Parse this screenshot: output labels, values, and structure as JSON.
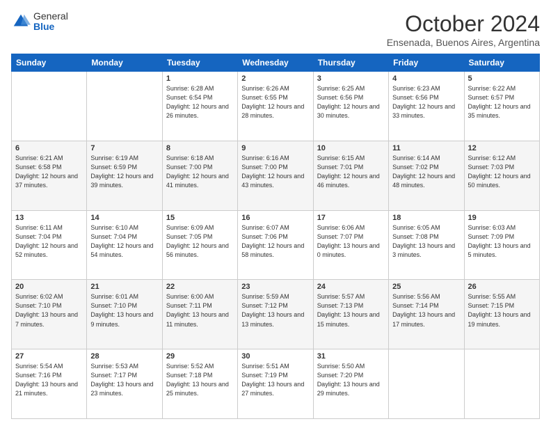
{
  "logo": {
    "general": "General",
    "blue": "Blue"
  },
  "header": {
    "month": "October 2024",
    "location": "Ensenada, Buenos Aires, Argentina"
  },
  "days_of_week": [
    "Sunday",
    "Monday",
    "Tuesday",
    "Wednesday",
    "Thursday",
    "Friday",
    "Saturday"
  ],
  "weeks": [
    [
      {
        "day": "",
        "sunrise": "",
        "sunset": "",
        "daylight": ""
      },
      {
        "day": "",
        "sunrise": "",
        "sunset": "",
        "daylight": ""
      },
      {
        "day": "1",
        "sunrise": "Sunrise: 6:28 AM",
        "sunset": "Sunset: 6:54 PM",
        "daylight": "Daylight: 12 hours and 26 minutes."
      },
      {
        "day": "2",
        "sunrise": "Sunrise: 6:26 AM",
        "sunset": "Sunset: 6:55 PM",
        "daylight": "Daylight: 12 hours and 28 minutes."
      },
      {
        "day": "3",
        "sunrise": "Sunrise: 6:25 AM",
        "sunset": "Sunset: 6:56 PM",
        "daylight": "Daylight: 12 hours and 30 minutes."
      },
      {
        "day": "4",
        "sunrise": "Sunrise: 6:23 AM",
        "sunset": "Sunset: 6:56 PM",
        "daylight": "Daylight: 12 hours and 33 minutes."
      },
      {
        "day": "5",
        "sunrise": "Sunrise: 6:22 AM",
        "sunset": "Sunset: 6:57 PM",
        "daylight": "Daylight: 12 hours and 35 minutes."
      }
    ],
    [
      {
        "day": "6",
        "sunrise": "Sunrise: 6:21 AM",
        "sunset": "Sunset: 6:58 PM",
        "daylight": "Daylight: 12 hours and 37 minutes."
      },
      {
        "day": "7",
        "sunrise": "Sunrise: 6:19 AM",
        "sunset": "Sunset: 6:59 PM",
        "daylight": "Daylight: 12 hours and 39 minutes."
      },
      {
        "day": "8",
        "sunrise": "Sunrise: 6:18 AM",
        "sunset": "Sunset: 7:00 PM",
        "daylight": "Daylight: 12 hours and 41 minutes."
      },
      {
        "day": "9",
        "sunrise": "Sunrise: 6:16 AM",
        "sunset": "Sunset: 7:00 PM",
        "daylight": "Daylight: 12 hours and 43 minutes."
      },
      {
        "day": "10",
        "sunrise": "Sunrise: 6:15 AM",
        "sunset": "Sunset: 7:01 PM",
        "daylight": "Daylight: 12 hours and 46 minutes."
      },
      {
        "day": "11",
        "sunrise": "Sunrise: 6:14 AM",
        "sunset": "Sunset: 7:02 PM",
        "daylight": "Daylight: 12 hours and 48 minutes."
      },
      {
        "day": "12",
        "sunrise": "Sunrise: 6:12 AM",
        "sunset": "Sunset: 7:03 PM",
        "daylight": "Daylight: 12 hours and 50 minutes."
      }
    ],
    [
      {
        "day": "13",
        "sunrise": "Sunrise: 6:11 AM",
        "sunset": "Sunset: 7:04 PM",
        "daylight": "Daylight: 12 hours and 52 minutes."
      },
      {
        "day": "14",
        "sunrise": "Sunrise: 6:10 AM",
        "sunset": "Sunset: 7:04 PM",
        "daylight": "Daylight: 12 hours and 54 minutes."
      },
      {
        "day": "15",
        "sunrise": "Sunrise: 6:09 AM",
        "sunset": "Sunset: 7:05 PM",
        "daylight": "Daylight: 12 hours and 56 minutes."
      },
      {
        "day": "16",
        "sunrise": "Sunrise: 6:07 AM",
        "sunset": "Sunset: 7:06 PM",
        "daylight": "Daylight: 12 hours and 58 minutes."
      },
      {
        "day": "17",
        "sunrise": "Sunrise: 6:06 AM",
        "sunset": "Sunset: 7:07 PM",
        "daylight": "Daylight: 13 hours and 0 minutes."
      },
      {
        "day": "18",
        "sunrise": "Sunrise: 6:05 AM",
        "sunset": "Sunset: 7:08 PM",
        "daylight": "Daylight: 13 hours and 3 minutes."
      },
      {
        "day": "19",
        "sunrise": "Sunrise: 6:03 AM",
        "sunset": "Sunset: 7:09 PM",
        "daylight": "Daylight: 13 hours and 5 minutes."
      }
    ],
    [
      {
        "day": "20",
        "sunrise": "Sunrise: 6:02 AM",
        "sunset": "Sunset: 7:10 PM",
        "daylight": "Daylight: 13 hours and 7 minutes."
      },
      {
        "day": "21",
        "sunrise": "Sunrise: 6:01 AM",
        "sunset": "Sunset: 7:10 PM",
        "daylight": "Daylight: 13 hours and 9 minutes."
      },
      {
        "day": "22",
        "sunrise": "Sunrise: 6:00 AM",
        "sunset": "Sunset: 7:11 PM",
        "daylight": "Daylight: 13 hours and 11 minutes."
      },
      {
        "day": "23",
        "sunrise": "Sunrise: 5:59 AM",
        "sunset": "Sunset: 7:12 PM",
        "daylight": "Daylight: 13 hours and 13 minutes."
      },
      {
        "day": "24",
        "sunrise": "Sunrise: 5:57 AM",
        "sunset": "Sunset: 7:13 PM",
        "daylight": "Daylight: 13 hours and 15 minutes."
      },
      {
        "day": "25",
        "sunrise": "Sunrise: 5:56 AM",
        "sunset": "Sunset: 7:14 PM",
        "daylight": "Daylight: 13 hours and 17 minutes."
      },
      {
        "day": "26",
        "sunrise": "Sunrise: 5:55 AM",
        "sunset": "Sunset: 7:15 PM",
        "daylight": "Daylight: 13 hours and 19 minutes."
      }
    ],
    [
      {
        "day": "27",
        "sunrise": "Sunrise: 5:54 AM",
        "sunset": "Sunset: 7:16 PM",
        "daylight": "Daylight: 13 hours and 21 minutes."
      },
      {
        "day": "28",
        "sunrise": "Sunrise: 5:53 AM",
        "sunset": "Sunset: 7:17 PM",
        "daylight": "Daylight: 13 hours and 23 minutes."
      },
      {
        "day": "29",
        "sunrise": "Sunrise: 5:52 AM",
        "sunset": "Sunset: 7:18 PM",
        "daylight": "Daylight: 13 hours and 25 minutes."
      },
      {
        "day": "30",
        "sunrise": "Sunrise: 5:51 AM",
        "sunset": "Sunset: 7:19 PM",
        "daylight": "Daylight: 13 hours and 27 minutes."
      },
      {
        "day": "31",
        "sunrise": "Sunrise: 5:50 AM",
        "sunset": "Sunset: 7:20 PM",
        "daylight": "Daylight: 13 hours and 29 minutes."
      },
      {
        "day": "",
        "sunrise": "",
        "sunset": "",
        "daylight": ""
      },
      {
        "day": "",
        "sunrise": "",
        "sunset": "",
        "daylight": ""
      }
    ]
  ]
}
